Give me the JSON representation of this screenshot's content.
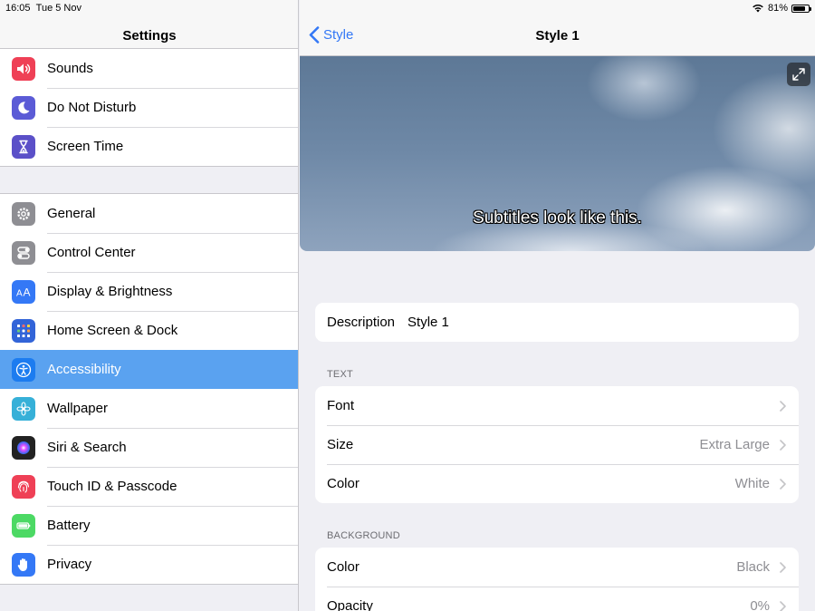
{
  "status": {
    "time": "16:05",
    "date": "Tue 5 Nov",
    "battery": "81%",
    "battery_level": 0.81
  },
  "sidebar": {
    "title": "Settings",
    "group1": [
      {
        "label": "Sounds",
        "icon": "speaker-icon",
        "color": "#ef4056"
      },
      {
        "label": "Do Not Disturb",
        "icon": "moon-icon",
        "color": "#5b5bd6"
      },
      {
        "label": "Screen Time",
        "icon": "hourglass-icon",
        "color": "#5b50c8"
      }
    ],
    "group2": [
      {
        "label": "General",
        "icon": "gear-icon",
        "color": "#8e8e93"
      },
      {
        "label": "Control Center",
        "icon": "toggles-icon",
        "color": "#8e8e93"
      },
      {
        "label": "Display & Brightness",
        "icon": "text-size-icon",
        "color": "#3478f6"
      },
      {
        "label": "Home Screen & Dock",
        "icon": "grid-icon",
        "color": "#3264d8"
      },
      {
        "label": "Accessibility",
        "icon": "accessibility-icon",
        "color": "#1c7cf0",
        "selected": true
      },
      {
        "label": "Wallpaper",
        "icon": "flower-icon",
        "color": "#36b0d8"
      },
      {
        "label": "Siri & Search",
        "icon": "siri-icon",
        "color": "#222222"
      },
      {
        "label": "Touch ID & Passcode",
        "icon": "fingerprint-icon",
        "color": "#ef4056"
      },
      {
        "label": "Battery",
        "icon": "battery-icon",
        "color": "#4cd964"
      },
      {
        "label": "Privacy",
        "icon": "hand-icon",
        "color": "#3478f6"
      }
    ]
  },
  "detail": {
    "back_label": "Style",
    "title": "Style 1",
    "preview_text": "Subtitles look like this.",
    "description_label": "Description",
    "description_value": "Style 1",
    "text_section": "TEXT",
    "text_rows": [
      {
        "label": "Font",
        "value": ""
      },
      {
        "label": "Size",
        "value": "Extra Large"
      },
      {
        "label": "Color",
        "value": "White"
      }
    ],
    "background_section": "BACKGROUND",
    "background_rows": [
      {
        "label": "Color",
        "value": "Black"
      },
      {
        "label": "Opacity",
        "value": "0%"
      }
    ]
  }
}
